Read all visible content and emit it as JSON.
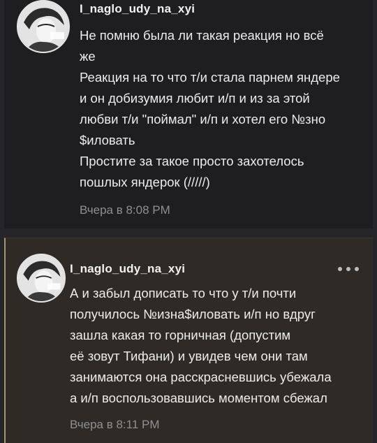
{
  "comments": [
    {
      "username": "I_naglo_udy_na_xyi",
      "message": "Не помню была ли такая реакция но всё\nже\nРеакция на то что т/и стала парнем яндере\nи он добизумия любит и/п и из за этой\nлюбви т/и \"поймал\" и/п и хотел его №зно\n$иловать\nПростите за такое просто захотелось\nпошлых яндерок (/////)",
      "timestamp": "Вчера в 8:08 PM",
      "avatar": "avatar-image"
    },
    {
      "username": "I_naglo_udy_na_xyi",
      "message": "А и забыл дописать то что у т/и почти\nполучилось №изна$иловать и/п но вдруг\nзашла какая то горничная (допустим\nеё зовут Тифани) и увидев чем они там\nзанимаются она расскрасневшись убежала\nа и/п воспользовавшись моментом сбежал",
      "timestamp": "Вчера в 8:11 PM",
      "avatar": "avatar-image",
      "more_icon": "more-options-icon"
    }
  ],
  "colors": {
    "background": "#26262a",
    "card_1": "#1e1e21",
    "card_2_highlight": "#2f2a25",
    "accent_border": "#a79672",
    "text": "#ececec",
    "timestamp": "#8f8f92"
  }
}
